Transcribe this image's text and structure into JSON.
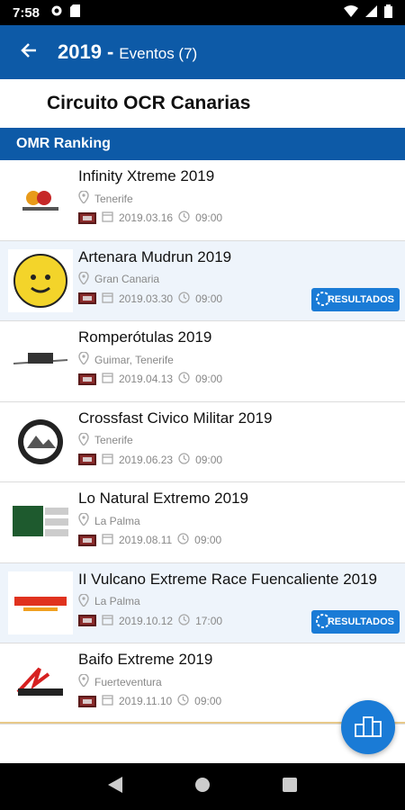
{
  "status_bar": {
    "time": "7:58"
  },
  "header": {
    "year": "2019",
    "separator": "-",
    "subtitle": "Eventos (7)"
  },
  "circuit": {
    "name": "Circuito OCR Canarias"
  },
  "section": {
    "title": "OMR Ranking"
  },
  "events": [
    {
      "title": "Infinity Xtreme 2019",
      "location": "Tenerife",
      "date": "2019.03.16",
      "time": "09:00",
      "results": ""
    },
    {
      "title": "Artenara Mudrun 2019",
      "location": "Gran Canaria",
      "date": "2019.03.30",
      "time": "09:00",
      "results": "RESULTADOS"
    },
    {
      "title": "Romperótulas 2019",
      "location": "Guimar, Tenerife",
      "date": "2019.04.13",
      "time": "09:00",
      "results": ""
    },
    {
      "title": "Crossfast Civico Militar 2019",
      "location": "Tenerife",
      "date": "2019.06.23",
      "time": "09:00",
      "results": ""
    },
    {
      "title": "Lo Natural Extremo 2019",
      "location": "La Palma",
      "date": "2019.08.11",
      "time": "09:00",
      "results": ""
    },
    {
      "title": "II Vulcano Extreme Race Fuencaliente 2019",
      "location": "La Palma",
      "date": "2019.10.12",
      "time": "17:00",
      "results": "RESULTADOS"
    },
    {
      "title": "Baifo Extreme 2019",
      "location": "Fuerteventura",
      "date": "2019.11.10",
      "time": "09:00",
      "results": ""
    }
  ],
  "colors": {
    "primary": "#0d5aa7",
    "accent": "#1a7bd6",
    "row_highlight": "#eef4fb"
  },
  "icons": {
    "back": "arrow-left-icon",
    "location": "map-pin-icon",
    "calendar": "calendar-icon",
    "clock": "clock-icon",
    "fab": "ranking-podium-icon"
  }
}
